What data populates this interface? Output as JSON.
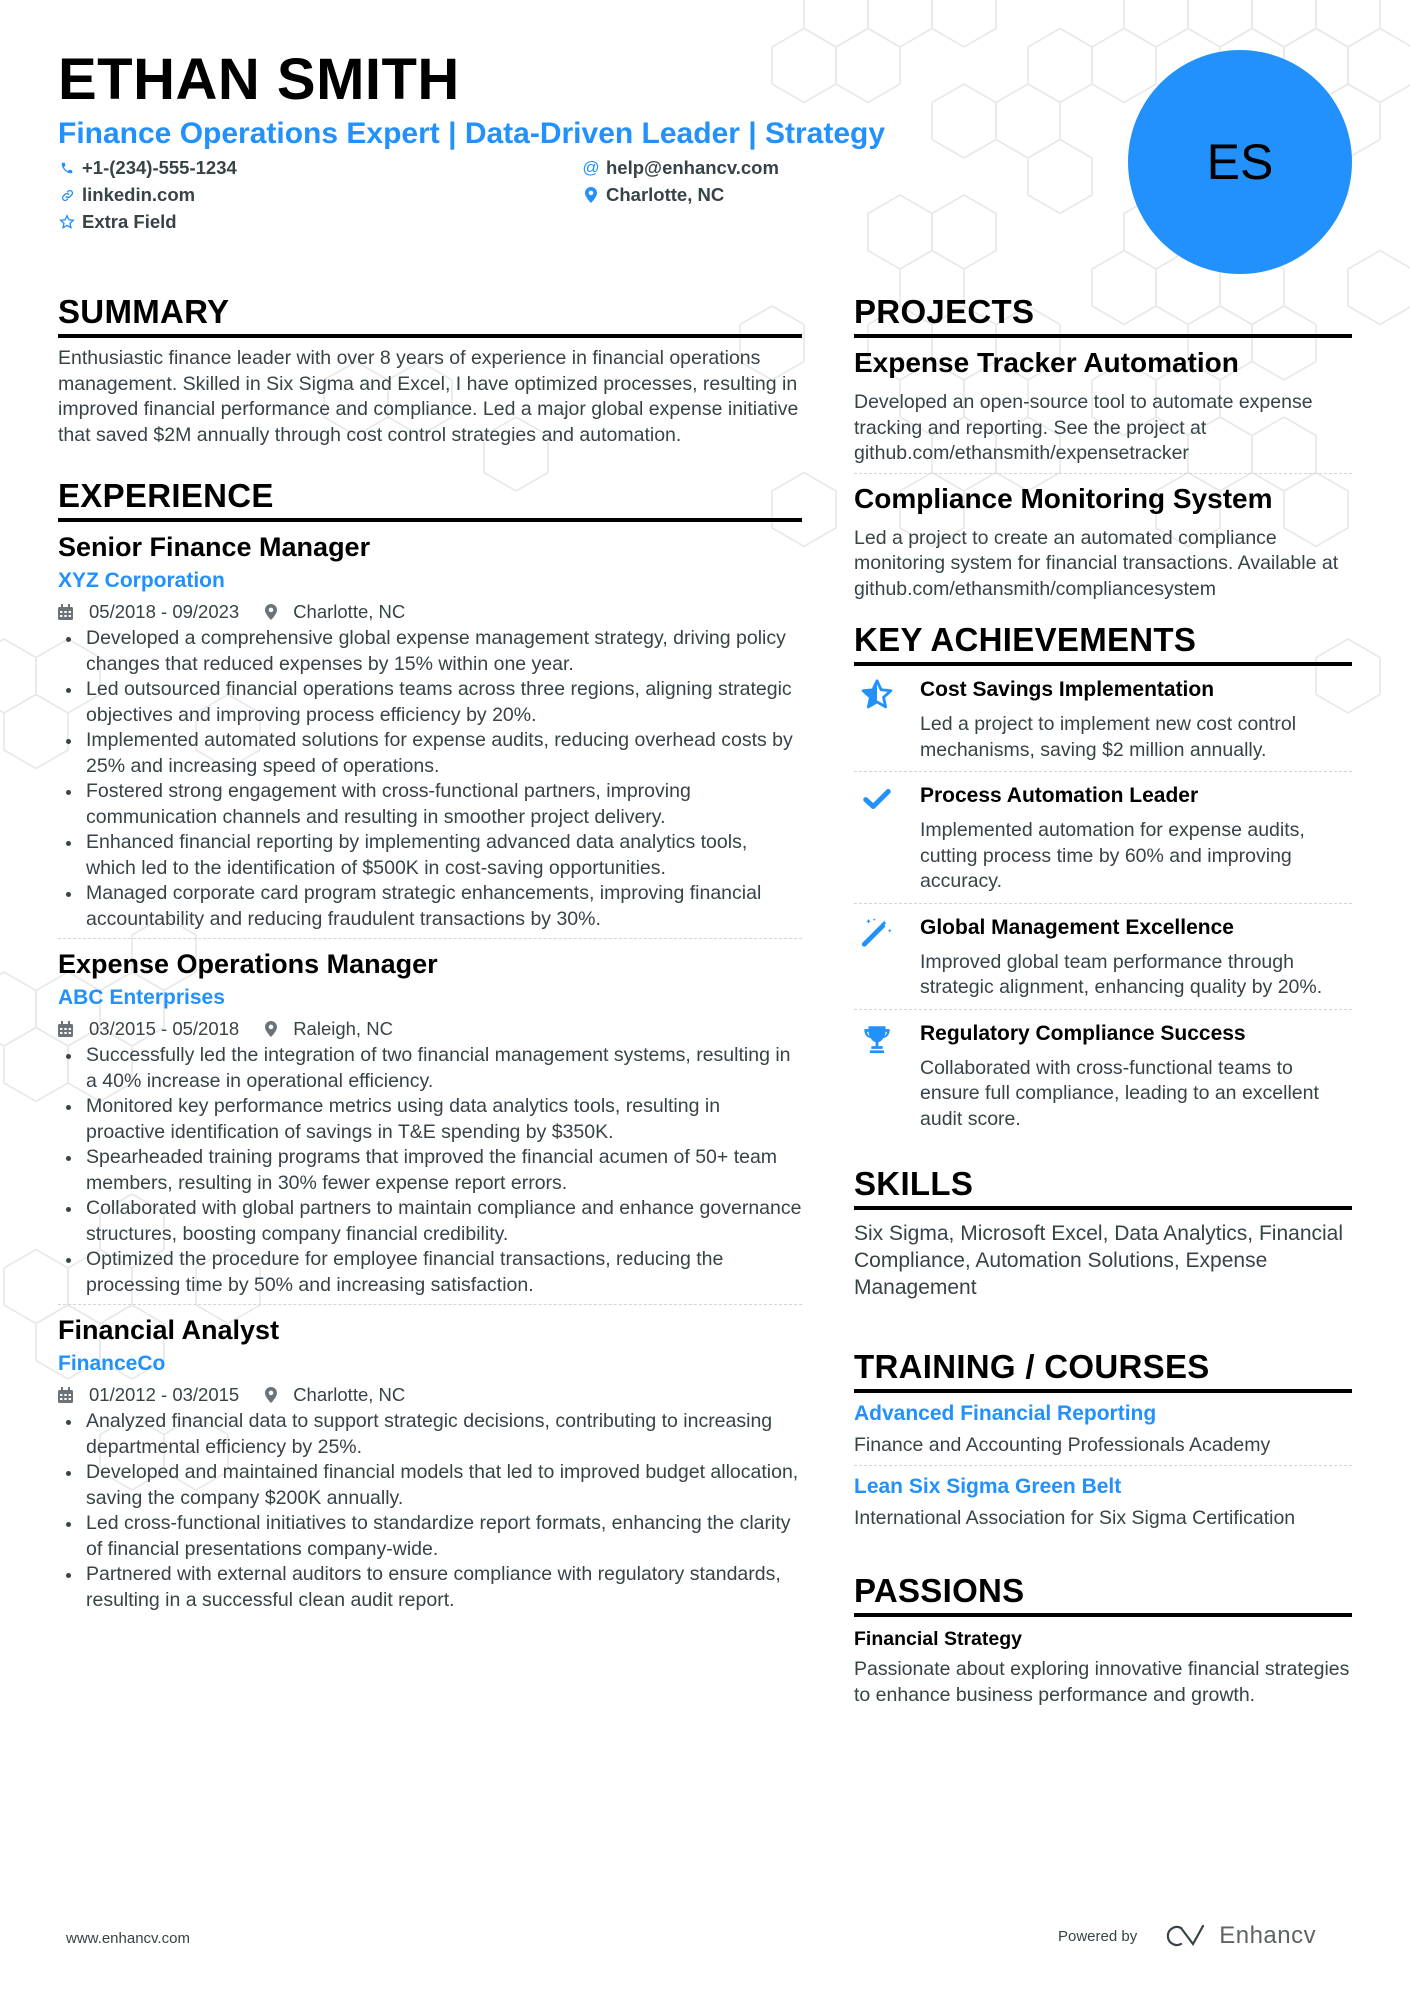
{
  "header": {
    "name": "ETHAN SMITH",
    "headline": "Finance Operations Expert | Data-Driven Leader | Strategy",
    "initials": "ES",
    "contacts": [
      {
        "icon": "phone-icon",
        "value": "+1-(234)-555-1234"
      },
      {
        "icon": "at-icon",
        "value": "help@enhancv.com"
      },
      {
        "icon": "link-icon",
        "value": "linkedin.com"
      },
      {
        "icon": "location-pin-icon",
        "value": "Charlotte, NC"
      },
      {
        "icon": "star-outline-icon",
        "value": "Extra Field"
      }
    ]
  },
  "accent_color": "#2291fc",
  "summary": {
    "title": "SUMMARY",
    "text": "Enthusiastic finance leader with over 8 years of experience in financial operations management. Skilled in Six Sigma and Excel, I have optimized processes, resulting in improved financial performance and compliance. Led a major global expense initiative that saved $2M annually through cost control strategies and automation."
  },
  "experience": {
    "title": "EXPERIENCE",
    "jobs": [
      {
        "title": "Senior Finance Manager",
        "company": "XYZ Corporation",
        "dates": "05/2018 - 09/2023",
        "location": "Charlotte, NC",
        "bullets": [
          "Developed a comprehensive global expense management strategy, driving policy changes that reduced expenses by 15% within one year.",
          "Led outsourced financial operations teams across three regions, aligning strategic objectives and improving process efficiency by 20%.",
          "Implemented automated solutions for expense audits, reducing overhead costs by 25% and increasing speed of operations.",
          "Fostered strong engagement with cross-functional partners, improving communication channels and resulting in smoother project delivery.",
          "Enhanced financial reporting by implementing advanced data analytics tools, which led to the identification of $500K in cost-saving opportunities.",
          "Managed corporate card program strategic enhancements, improving financial accountability and reducing fraudulent transactions by 30%."
        ]
      },
      {
        "title": "Expense Operations Manager",
        "company": "ABC Enterprises",
        "dates": "03/2015 - 05/2018",
        "location": "Raleigh, NC",
        "bullets": [
          "Successfully led the integration of two financial management systems, resulting in a 40% increase in operational efficiency.",
          "Monitored key performance metrics using data analytics tools, resulting in proactive identification of savings in T&E spending by $350K.",
          "Spearheaded training programs that improved the financial acumen of 50+ team members, resulting in 30% fewer expense report errors.",
          "Collaborated with global partners to maintain compliance and enhance governance structures, boosting company financial credibility.",
          "Optimized the procedure for employee financial transactions, reducing the processing time by 50% and increasing satisfaction."
        ]
      },
      {
        "title": "Financial Analyst",
        "company": "FinanceCo",
        "dates": "01/2012 - 03/2015",
        "location": "Charlotte, NC",
        "bullets": [
          "Analyzed financial data to support strategic decisions, contributing to increasing departmental efficiency by 25%.",
          "Developed and maintained financial models that led to improved budget allocation, saving the company $200K annually.",
          "Led cross-functional initiatives to standardize report formats, enhancing the clarity of financial presentations company-wide.",
          "Partnered with external auditors to ensure compliance with regulatory standards, resulting in a successful clean audit report."
        ]
      }
    ]
  },
  "projects": {
    "title": "PROJECTS",
    "items": [
      {
        "title": "Expense Tracker Automation",
        "description": "Developed an open-source tool to automate expense tracking and reporting. See the project at github.com/ethansmith/expensetracker"
      },
      {
        "title": "Compliance Monitoring System",
        "description": "Led a project to create an automated compliance monitoring system for financial transactions. Available at github.com/ethansmith/compliancesystem"
      }
    ]
  },
  "achievements": {
    "title": "KEY ACHIEVEMENTS",
    "items": [
      {
        "icon": "star-half-icon",
        "title": "Cost Savings Implementation",
        "description": "Led a project to implement new cost control mechanisms, saving $2 million annually."
      },
      {
        "icon": "checkmark-icon",
        "title": "Process Automation Leader",
        "description": "Implemented automation for expense audits, cutting process time by 60% and improving accuracy."
      },
      {
        "icon": "magic-wand-icon",
        "title": "Global Management Excellence",
        "description": "Improved global team performance through strategic alignment, enhancing quality by 20%."
      },
      {
        "icon": "trophy-icon",
        "title": "Regulatory Compliance Success",
        "description": "Collaborated with cross-functional teams to ensure full compliance, leading to an excellent audit score."
      }
    ]
  },
  "skills": {
    "title": "SKILLS",
    "text": "Six Sigma, Microsoft Excel, Data Analytics, Financial Compliance, Automation Solutions, Expense Management"
  },
  "training": {
    "title": "TRAINING / COURSES",
    "items": [
      {
        "title": "Advanced Financial Reporting",
        "organization": "Finance and Accounting Professionals Academy"
      },
      {
        "title": "Lean Six Sigma Green Belt",
        "organization": "International Association for Six Sigma Certification"
      }
    ]
  },
  "passions": {
    "title": "PASSIONS",
    "items": [
      {
        "title": "Financial Strategy",
        "description": "Passionate about exploring innovative financial strategies to enhance business performance and growth."
      }
    ]
  },
  "footer": {
    "website": "www.enhancv.com",
    "powered_by": "Powered by",
    "brand": "Enhancv"
  }
}
